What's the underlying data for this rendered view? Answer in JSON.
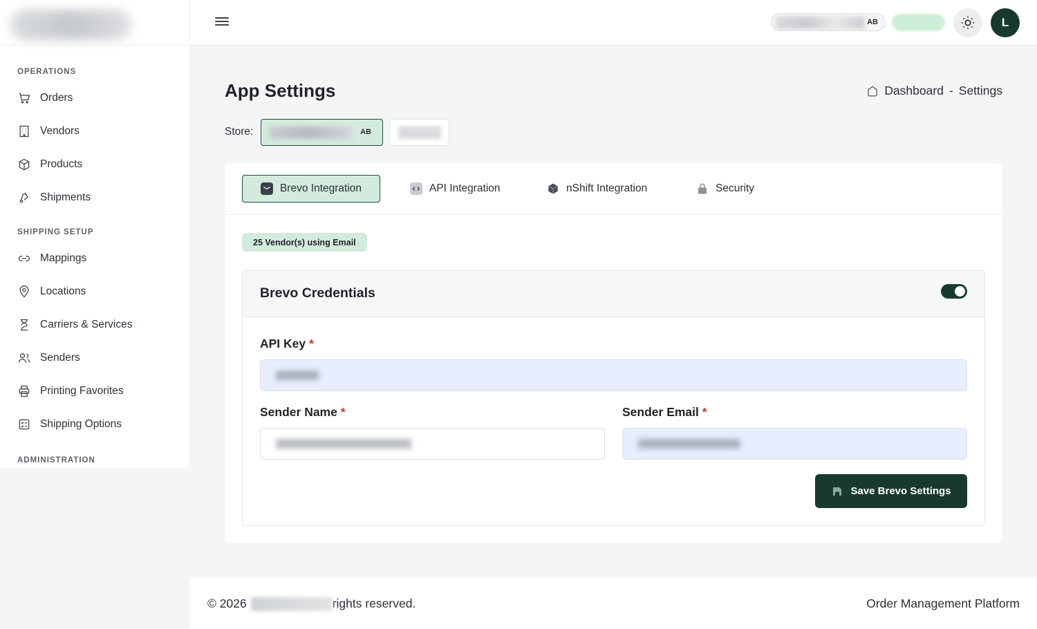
{
  "sidebar": {
    "sections": [
      {
        "title": "OPERATIONS",
        "items": [
          {
            "label": "Orders",
            "icon": "cart-icon"
          },
          {
            "label": "Vendors",
            "icon": "building-icon"
          },
          {
            "label": "Products",
            "icon": "box-icon"
          },
          {
            "label": "Shipments",
            "icon": "delivery-icon"
          }
        ]
      },
      {
        "title": "SHIPPING SETUP",
        "items": [
          {
            "label": "Mappings",
            "icon": "link-icon"
          },
          {
            "label": "Locations",
            "icon": "map-pin-icon"
          },
          {
            "label": "Carriers & Services",
            "icon": "hourglass-icon"
          },
          {
            "label": "Senders",
            "icon": "users-icon"
          },
          {
            "label": "Printing Favorites",
            "icon": "printer-icon"
          },
          {
            "label": "Shipping Options",
            "icon": "checklist-icon"
          }
        ]
      },
      {
        "title": "ADMINISTRATION",
        "items": []
      }
    ]
  },
  "header": {
    "store_code": "AB",
    "avatar_initial": "L"
  },
  "page": {
    "title": "App Settings",
    "breadcrumb": {
      "home": "Dashboard",
      "separator": "-",
      "current": "Settings"
    },
    "store_label": "Store:",
    "store_active_code": "AB"
  },
  "tabs": [
    {
      "label": "Brevo Integration",
      "icon": "mail-icon",
      "active": true
    },
    {
      "label": "API Integration",
      "icon": "code-icon",
      "active": false
    },
    {
      "label": "nShift Integration",
      "icon": "cube-icon",
      "active": false
    },
    {
      "label": "Security",
      "icon": "lock-icon",
      "active": false
    }
  ],
  "vendor_badge": "25 Vendor(s) using Email",
  "credentials": {
    "title": "Brevo Credentials",
    "enabled": true,
    "api_key_label": "API Key",
    "sender_name_label": "Sender Name",
    "sender_email_label": "Sender Email",
    "required_mark": "*",
    "save_label": "Save Brevo Settings"
  },
  "footer": {
    "copyright_prefix": "© 2026",
    "copyright_suffix": "rights reserved.",
    "platform": "Order Management Platform"
  },
  "colors": {
    "accent_dark": "#173a2c",
    "accent_light": "#d3ebdd",
    "required": "#d13438",
    "input_filled": "#e8eefe"
  }
}
